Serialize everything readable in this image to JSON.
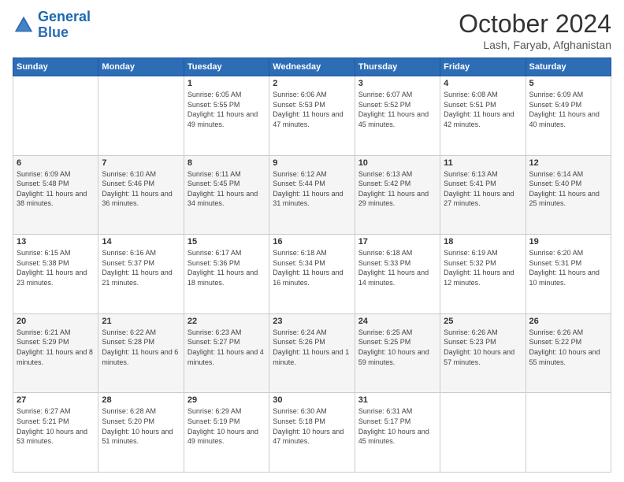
{
  "logo": {
    "line1": "General",
    "line2": "Blue"
  },
  "header": {
    "month": "October 2024",
    "location": "Lash, Faryab, Afghanistan"
  },
  "weekdays": [
    "Sunday",
    "Monday",
    "Tuesday",
    "Wednesday",
    "Thursday",
    "Friday",
    "Saturday"
  ],
  "weeks": [
    [
      {
        "day": "",
        "info": ""
      },
      {
        "day": "",
        "info": ""
      },
      {
        "day": "1",
        "info": "Sunrise: 6:05 AM\nSunset: 5:55 PM\nDaylight: 11 hours and 49 minutes."
      },
      {
        "day": "2",
        "info": "Sunrise: 6:06 AM\nSunset: 5:53 PM\nDaylight: 11 hours and 47 minutes."
      },
      {
        "day": "3",
        "info": "Sunrise: 6:07 AM\nSunset: 5:52 PM\nDaylight: 11 hours and 45 minutes."
      },
      {
        "day": "4",
        "info": "Sunrise: 6:08 AM\nSunset: 5:51 PM\nDaylight: 11 hours and 42 minutes."
      },
      {
        "day": "5",
        "info": "Sunrise: 6:09 AM\nSunset: 5:49 PM\nDaylight: 11 hours and 40 minutes."
      }
    ],
    [
      {
        "day": "6",
        "info": "Sunrise: 6:09 AM\nSunset: 5:48 PM\nDaylight: 11 hours and 38 minutes."
      },
      {
        "day": "7",
        "info": "Sunrise: 6:10 AM\nSunset: 5:46 PM\nDaylight: 11 hours and 36 minutes."
      },
      {
        "day": "8",
        "info": "Sunrise: 6:11 AM\nSunset: 5:45 PM\nDaylight: 11 hours and 34 minutes."
      },
      {
        "day": "9",
        "info": "Sunrise: 6:12 AM\nSunset: 5:44 PM\nDaylight: 11 hours and 31 minutes."
      },
      {
        "day": "10",
        "info": "Sunrise: 6:13 AM\nSunset: 5:42 PM\nDaylight: 11 hours and 29 minutes."
      },
      {
        "day": "11",
        "info": "Sunrise: 6:13 AM\nSunset: 5:41 PM\nDaylight: 11 hours and 27 minutes."
      },
      {
        "day": "12",
        "info": "Sunrise: 6:14 AM\nSunset: 5:40 PM\nDaylight: 11 hours and 25 minutes."
      }
    ],
    [
      {
        "day": "13",
        "info": "Sunrise: 6:15 AM\nSunset: 5:38 PM\nDaylight: 11 hours and 23 minutes."
      },
      {
        "day": "14",
        "info": "Sunrise: 6:16 AM\nSunset: 5:37 PM\nDaylight: 11 hours and 21 minutes."
      },
      {
        "day": "15",
        "info": "Sunrise: 6:17 AM\nSunset: 5:36 PM\nDaylight: 11 hours and 18 minutes."
      },
      {
        "day": "16",
        "info": "Sunrise: 6:18 AM\nSunset: 5:34 PM\nDaylight: 11 hours and 16 minutes."
      },
      {
        "day": "17",
        "info": "Sunrise: 6:18 AM\nSunset: 5:33 PM\nDaylight: 11 hours and 14 minutes."
      },
      {
        "day": "18",
        "info": "Sunrise: 6:19 AM\nSunset: 5:32 PM\nDaylight: 11 hours and 12 minutes."
      },
      {
        "day": "19",
        "info": "Sunrise: 6:20 AM\nSunset: 5:31 PM\nDaylight: 11 hours and 10 minutes."
      }
    ],
    [
      {
        "day": "20",
        "info": "Sunrise: 6:21 AM\nSunset: 5:29 PM\nDaylight: 11 hours and 8 minutes."
      },
      {
        "day": "21",
        "info": "Sunrise: 6:22 AM\nSunset: 5:28 PM\nDaylight: 11 hours and 6 minutes."
      },
      {
        "day": "22",
        "info": "Sunrise: 6:23 AM\nSunset: 5:27 PM\nDaylight: 11 hours and 4 minutes."
      },
      {
        "day": "23",
        "info": "Sunrise: 6:24 AM\nSunset: 5:26 PM\nDaylight: 11 hours and 1 minute."
      },
      {
        "day": "24",
        "info": "Sunrise: 6:25 AM\nSunset: 5:25 PM\nDaylight: 10 hours and 59 minutes."
      },
      {
        "day": "25",
        "info": "Sunrise: 6:26 AM\nSunset: 5:23 PM\nDaylight: 10 hours and 57 minutes."
      },
      {
        "day": "26",
        "info": "Sunrise: 6:26 AM\nSunset: 5:22 PM\nDaylight: 10 hours and 55 minutes."
      }
    ],
    [
      {
        "day": "27",
        "info": "Sunrise: 6:27 AM\nSunset: 5:21 PM\nDaylight: 10 hours and 53 minutes."
      },
      {
        "day": "28",
        "info": "Sunrise: 6:28 AM\nSunset: 5:20 PM\nDaylight: 10 hours and 51 minutes."
      },
      {
        "day": "29",
        "info": "Sunrise: 6:29 AM\nSunset: 5:19 PM\nDaylight: 10 hours and 49 minutes."
      },
      {
        "day": "30",
        "info": "Sunrise: 6:30 AM\nSunset: 5:18 PM\nDaylight: 10 hours and 47 minutes."
      },
      {
        "day": "31",
        "info": "Sunrise: 6:31 AM\nSunset: 5:17 PM\nDaylight: 10 hours and 45 minutes."
      },
      {
        "day": "",
        "info": ""
      },
      {
        "day": "",
        "info": ""
      }
    ]
  ]
}
